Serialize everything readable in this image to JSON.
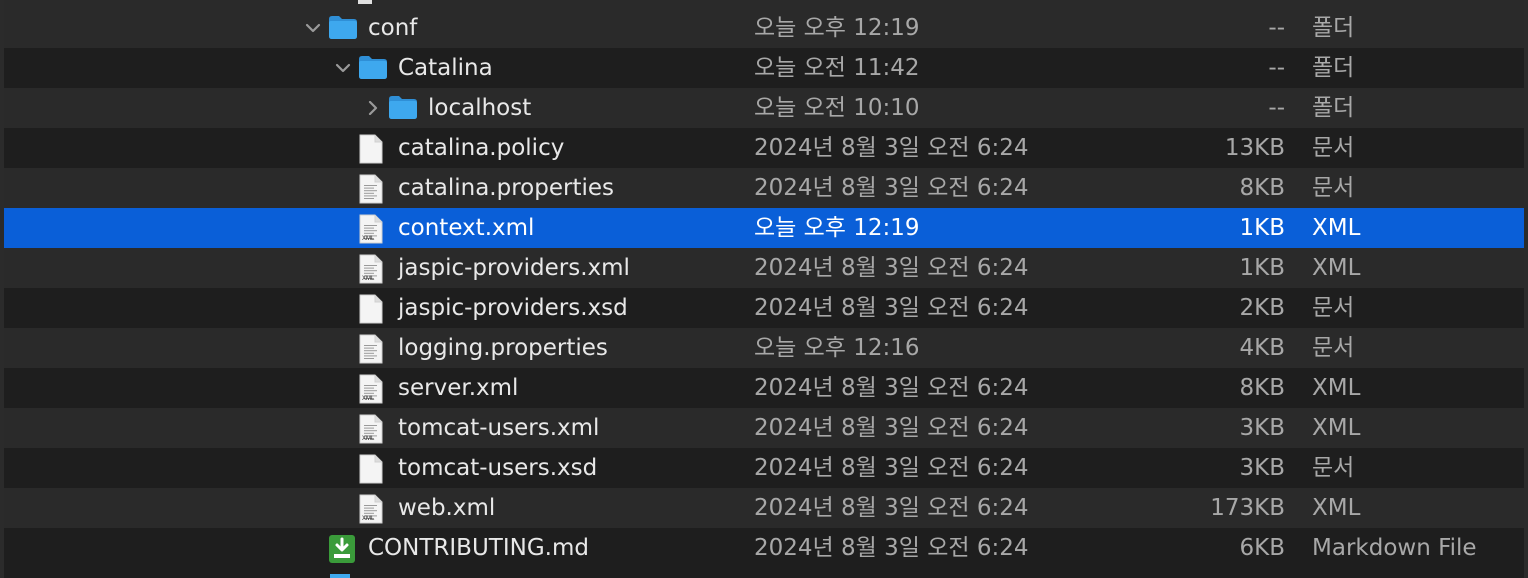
{
  "rows": [
    {
      "name": "conf",
      "type": "folder",
      "disclosure": "expanded",
      "level": 0,
      "date": "오늘 오후 12:19",
      "size": "--",
      "kind": "폴더"
    },
    {
      "name": "Catalina",
      "type": "folder",
      "disclosure": "expanded",
      "level": 1,
      "date": "오늘 오전 11:42",
      "size": "--",
      "kind": "폴더"
    },
    {
      "name": "localhost",
      "type": "folder",
      "disclosure": "collapsed",
      "level": 2,
      "date": "오늘 오전 10:10",
      "size": "--",
      "kind": "폴더"
    },
    {
      "name": "catalina.policy",
      "type": "doc",
      "level": 1,
      "date": "2024년 8월 3일 오전 6:24",
      "size": "13KB",
      "kind": "문서"
    },
    {
      "name": "catalina.properties",
      "type": "text",
      "level": 1,
      "date": "2024년 8월 3일 오전 6:24",
      "size": "8KB",
      "kind": "문서"
    },
    {
      "name": "context.xml",
      "type": "xml",
      "level": 1,
      "date": "오늘 오후 12:19",
      "size": "1KB",
      "kind": "XML",
      "selected": true
    },
    {
      "name": "jaspic-providers.xml",
      "type": "xml",
      "level": 1,
      "date": "2024년 8월 3일 오전 6:24",
      "size": "1KB",
      "kind": "XML"
    },
    {
      "name": "jaspic-providers.xsd",
      "type": "doc",
      "level": 1,
      "date": "2024년 8월 3일 오전 6:24",
      "size": "2KB",
      "kind": "문서"
    },
    {
      "name": "logging.properties",
      "type": "text",
      "level": 1,
      "date": "오늘 오후 12:16",
      "size": "4KB",
      "kind": "문서"
    },
    {
      "name": "server.xml",
      "type": "xml",
      "level": 1,
      "date": "2024년 8월 3일 오전 6:24",
      "size": "8KB",
      "kind": "XML"
    },
    {
      "name": "tomcat-users.xml",
      "type": "xml",
      "level": 1,
      "date": "2024년 8월 3일 오전 6:24",
      "size": "3KB",
      "kind": "XML"
    },
    {
      "name": "tomcat-users.xsd",
      "type": "doc",
      "level": 1,
      "date": "2024년 8월 3일 오전 6:24",
      "size": "3KB",
      "kind": "문서"
    },
    {
      "name": "web.xml",
      "type": "xml",
      "level": 1,
      "date": "2024년 8월 3일 오전 6:24",
      "size": "173KB",
      "kind": "XML"
    },
    {
      "name": "CONTRIBUTING.md",
      "type": "markdown",
      "level": 0,
      "date": "2024년 8월 3일 오전 6:24",
      "size": "6KB",
      "kind": "Markdown File"
    }
  ],
  "icon_labels": {
    "xml": "XML"
  },
  "colors": {
    "selection": "#0a5fd8",
    "folder": "#3ea8ee",
    "markdown": "#3a9b3a"
  }
}
